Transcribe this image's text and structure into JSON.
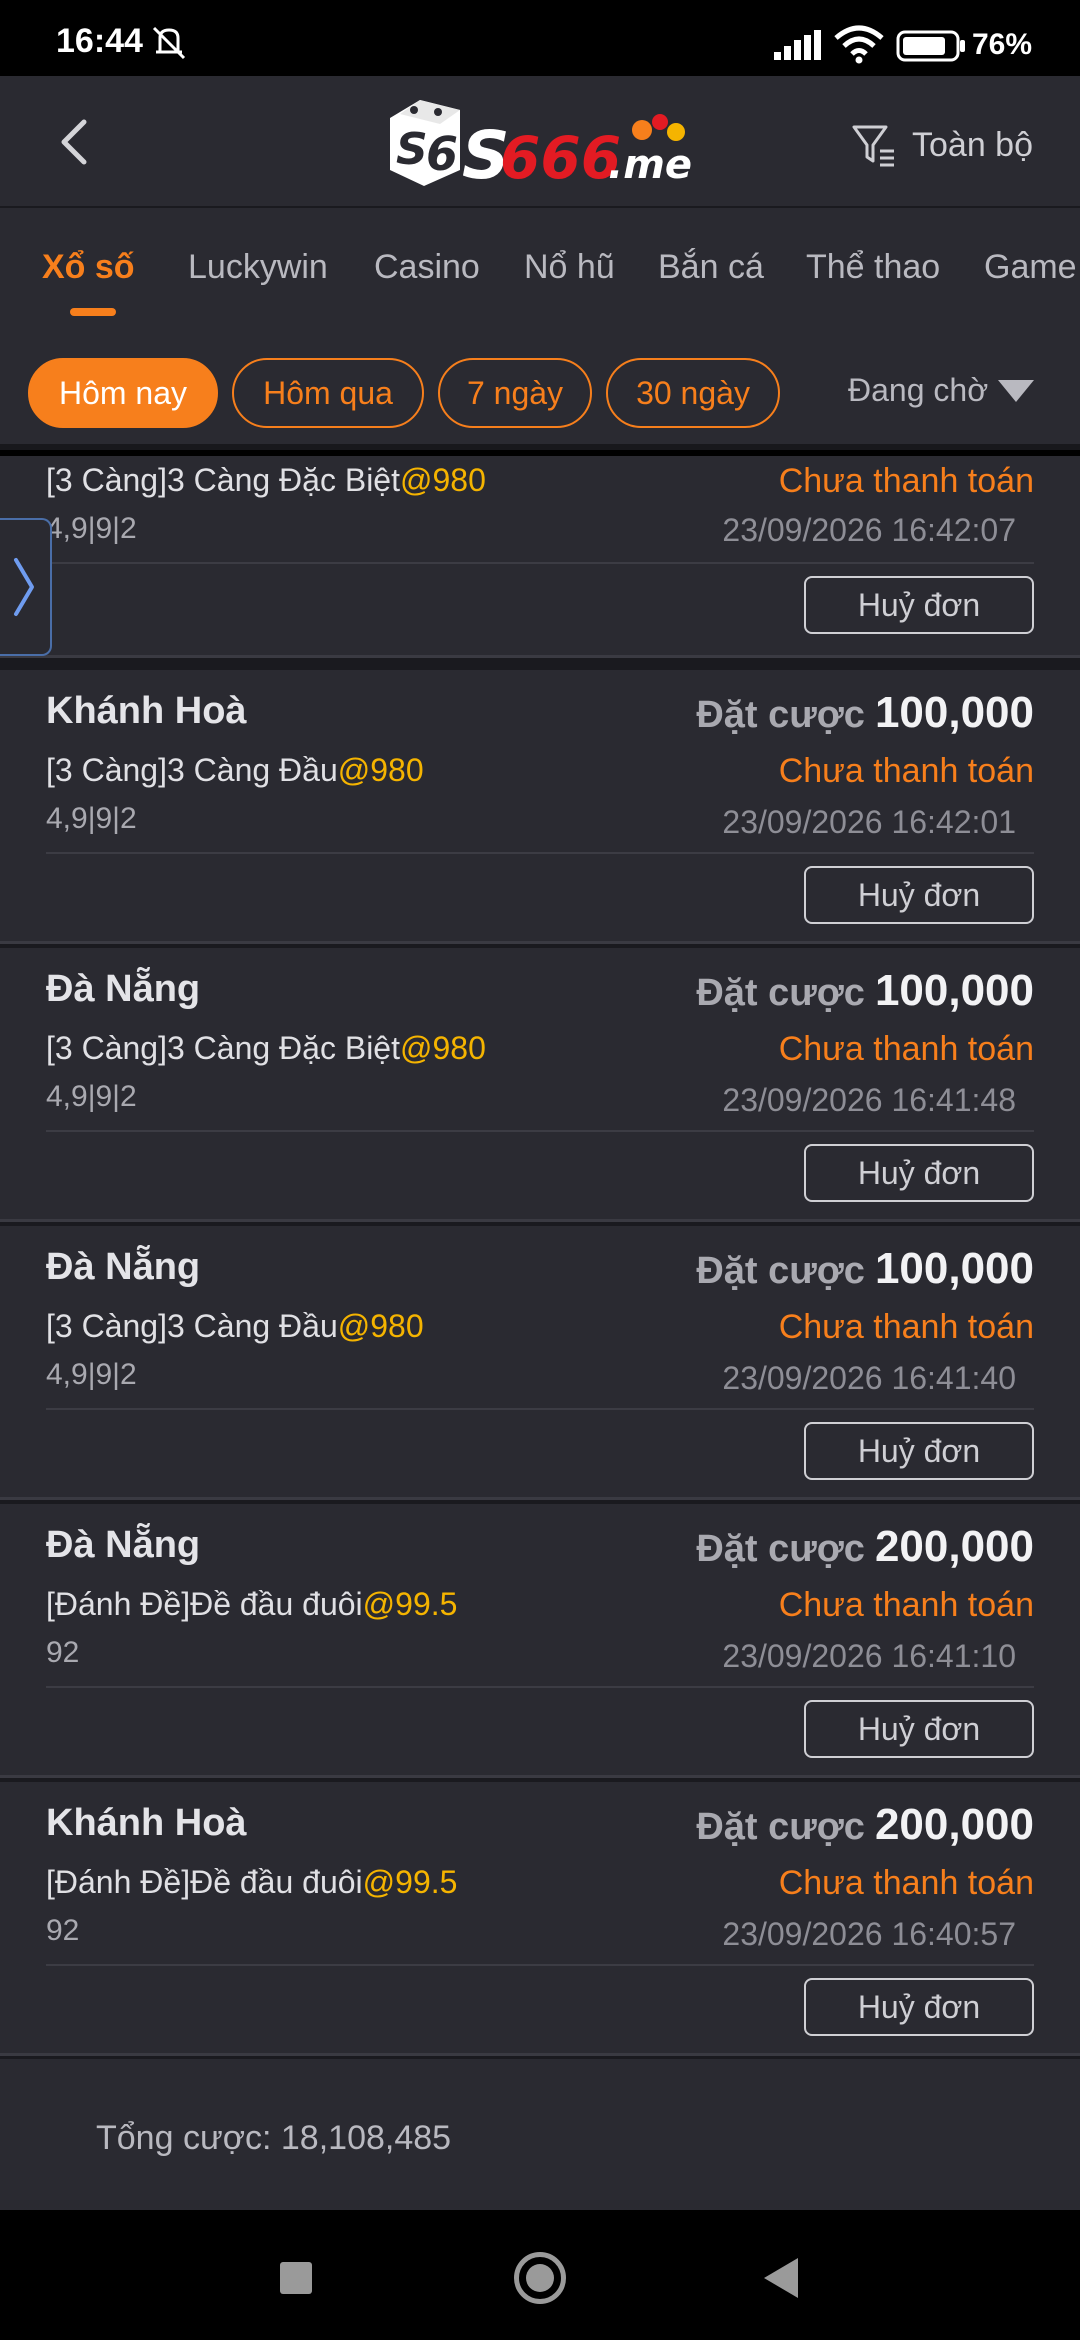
{
  "status_bar": {
    "time": "16:44",
    "battery": "76%"
  },
  "header": {
    "logo_text": "S666.me",
    "filter_label": "Toàn bộ"
  },
  "tabs": [
    "Xổ số",
    "Luckywin",
    "Casino",
    "Nổ hũ",
    "Bắn cá",
    "Thể thao",
    "Game"
  ],
  "date_filters": [
    "Hôm nay",
    "Hôm qua",
    "7 ngày",
    "30 ngày"
  ],
  "status_filter": "Đang chờ",
  "bet_label": "Đặt cược",
  "cancel_label": "Huỷ đơn",
  "bets": [
    {
      "region": "",
      "amount": "",
      "type": "[3 Càng]3 Càng Đặc Biệt",
      "odds": "@980",
      "numbers": "4,9|9|2",
      "status": "Chưa thanh toán",
      "datetime": "23/09/2026 16:42:07"
    },
    {
      "region": "Khánh Hoà",
      "amount": "100,000",
      "type": "[3 Càng]3 Càng Đầu",
      "odds": "@980",
      "numbers": "4,9|9|2",
      "status": "Chưa thanh toán",
      "datetime": "23/09/2026 16:42:01"
    },
    {
      "region": "Đà Nẵng",
      "amount": "100,000",
      "type": "[3 Càng]3 Càng Đặc Biệt",
      "odds": "@980",
      "numbers": "4,9|9|2",
      "status": "Chưa thanh toán",
      "datetime": "23/09/2026 16:41:48"
    },
    {
      "region": "Đà Nẵng",
      "amount": "100,000",
      "type": "[3 Càng]3 Càng Đầu",
      "odds": "@980",
      "numbers": "4,9|9|2",
      "status": "Chưa thanh toán",
      "datetime": "23/09/2026 16:41:40"
    },
    {
      "region": "Đà Nẵng",
      "amount": "200,000",
      "type": "[Đánh Đề]Đề đầu đuôi",
      "odds": "@99.5",
      "numbers": "92",
      "status": "Chưa thanh toán",
      "datetime": "23/09/2026 16:41:10"
    },
    {
      "region": "Khánh Hoà",
      "amount": "200,000",
      "type": "[Đánh Đề]Đề đầu đuôi",
      "odds": "@99.5",
      "numbers": "92",
      "status": "Chưa thanh toán",
      "datetime": "23/09/2026 16:40:57"
    }
  ],
  "footer": {
    "total_label": "Tổng cược: 18,108,485"
  },
  "colors": {
    "accent": "#f77f1c",
    "odds": "#f5b400",
    "background": "#2a2a31"
  }
}
